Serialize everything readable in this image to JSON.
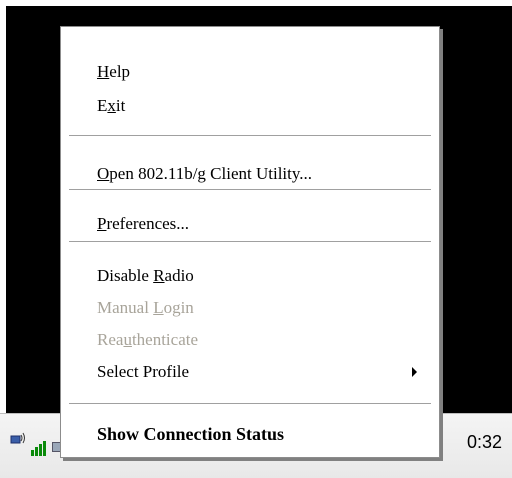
{
  "menu": {
    "help": {
      "mn": "H",
      "rest": "elp"
    },
    "exit": {
      "pre": "E",
      "mn": "x",
      "rest": "it"
    },
    "open_utility": {
      "mn": "O",
      "rest": "pen 802.11b/g Client Utility..."
    },
    "preferences": {
      "mn": "P",
      "rest": "references..."
    },
    "disable_radio": {
      "pre": "Disable ",
      "mn": "R",
      "rest": "adio"
    },
    "manual_login": {
      "pre": "Manual ",
      "mn": "L",
      "rest": "ogin"
    },
    "reauthenticate": {
      "pre": "Rea",
      "mn": "u",
      "rest": "thenticate"
    },
    "select_profile": "Select Profile",
    "show_status": "Show Connection Status"
  },
  "tray": {
    "clock": "0:32"
  }
}
